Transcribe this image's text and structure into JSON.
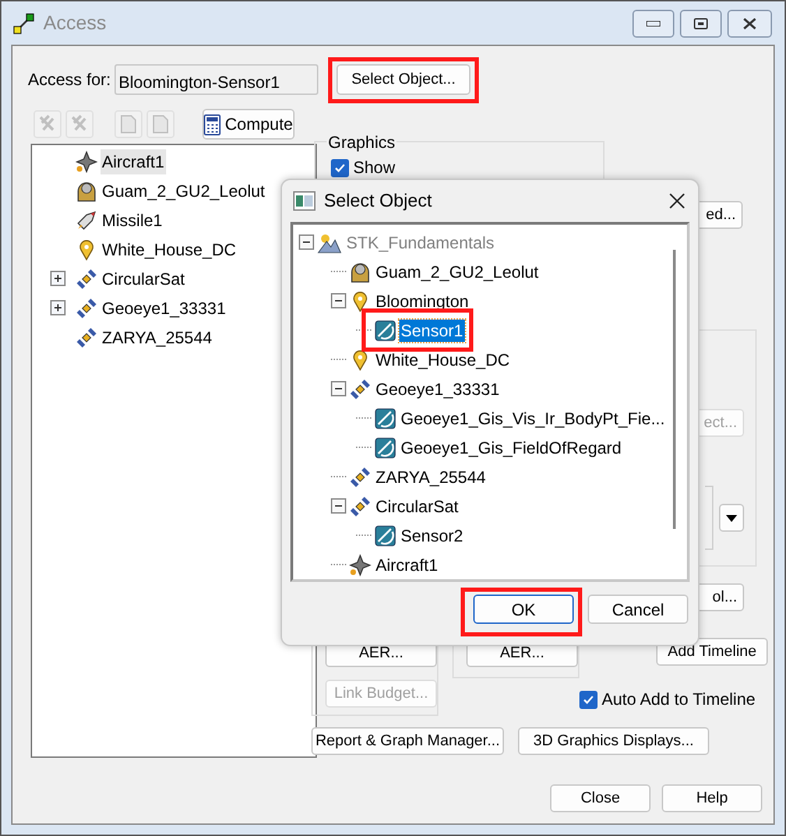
{
  "window": {
    "title": "Access"
  },
  "access_for": {
    "label": "Access for:",
    "value": "Bloomington-Sensor1"
  },
  "select_object_button": {
    "label": "Select Object...",
    "highlighted": true
  },
  "compute_button": {
    "label": "Compute"
  },
  "objects": [
    {
      "label": "Aircraft1",
      "kind": "aircraft",
      "expandable": false,
      "selected": true
    },
    {
      "label": "Guam_2_GU2_Leolut",
      "kind": "facility",
      "expandable": false,
      "selected": false
    },
    {
      "label": "Missile1",
      "kind": "missile",
      "expandable": false,
      "selected": false
    },
    {
      "label": "White_House_DC",
      "kind": "place",
      "expandable": false,
      "selected": false
    },
    {
      "label": "CircularSat",
      "kind": "satellite",
      "expandable": true,
      "selected": false
    },
    {
      "label": "Geoeye1_33331",
      "kind": "satellite",
      "expandable": true,
      "selected": false
    },
    {
      "label": "ZARYA_25544",
      "kind": "satellite",
      "expandable": false,
      "selected": false
    }
  ],
  "graphics": {
    "title": "Graphics",
    "show": {
      "label": "Show",
      "checked": true
    }
  },
  "partial_buttons": [
    {
      "label": "ed...",
      "disabled": false
    },
    {
      "label": "ect...",
      "disabled": true
    },
    {
      "label": "ol...",
      "disabled": false
    }
  ],
  "aer_buttons": [
    {
      "label": "AER..."
    },
    {
      "label": "AER..."
    }
  ],
  "link_budget_button": {
    "label": "Link Budget...",
    "disabled": true
  },
  "add_timeline_button": {
    "label": "Add Timeline"
  },
  "auto_add": {
    "label": "Auto Add to Timeline",
    "checked": true
  },
  "report_button": {
    "label": "Report & Graph Manager..."
  },
  "graphics_displays_button": {
    "label": "3D Graphics Displays..."
  },
  "footer_buttons": [
    {
      "label": "Close"
    },
    {
      "label": "Help"
    }
  ],
  "dialog": {
    "title": "Select Object",
    "tree": {
      "label": "STK_Fundamentals",
      "kind": "scenario",
      "expanded": true,
      "selected": false,
      "highlighted": false,
      "children": [
        {
          "label": "Guam_2_GU2_Leolut",
          "kind": "facility",
          "selected": false,
          "highlighted": false
        },
        {
          "label": "Bloomington",
          "kind": "place",
          "expanded": true,
          "selected": false,
          "highlighted": false,
          "children": [
            {
              "label": "Sensor1",
              "kind": "sensor",
              "selected": true,
              "highlighted": true
            }
          ]
        },
        {
          "label": "White_House_DC",
          "kind": "place",
          "selected": false,
          "highlighted": false
        },
        {
          "label": "Geoeye1_33331",
          "kind": "satellite",
          "expanded": true,
          "selected": false,
          "highlighted": false,
          "children": [
            {
              "label": "Geoeye1_Gis_Vis_Ir_BodyPt_Fie...",
              "kind": "sensor",
              "selected": false,
              "highlighted": false
            },
            {
              "label": "Geoeye1_Gis_FieldOfRegard",
              "kind": "sensor",
              "selected": false,
              "highlighted": false
            }
          ]
        },
        {
          "label": "ZARYA_25544",
          "kind": "satellite",
          "selected": false,
          "highlighted": false
        },
        {
          "label": "CircularSat",
          "kind": "satellite",
          "expanded": true,
          "selected": false,
          "highlighted": false,
          "children": [
            {
              "label": "Sensor2",
              "kind": "sensor",
              "selected": false,
              "highlighted": false
            }
          ]
        },
        {
          "label": "Aircraft1",
          "kind": "aircraft",
          "selected": false,
          "highlighted": false
        }
      ]
    },
    "buttons": [
      {
        "label": "OK",
        "default": true,
        "highlighted": true
      },
      {
        "label": "Cancel",
        "default": false,
        "highlighted": false
      }
    ]
  }
}
